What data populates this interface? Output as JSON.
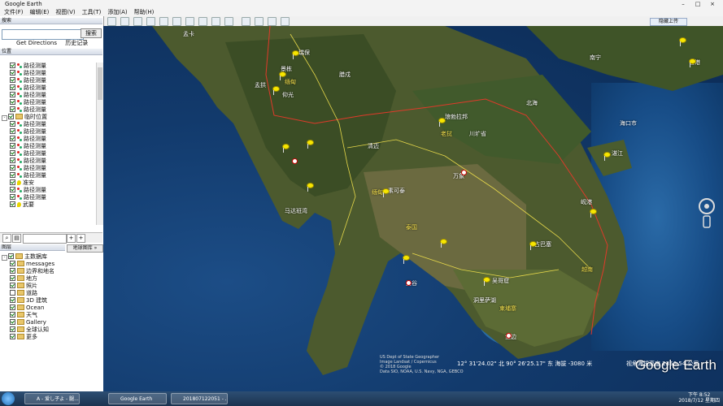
{
  "window": {
    "title": "Google Earth"
  },
  "menu": [
    "文件(F)",
    "编辑(E)",
    "视图(V)",
    "工具(T)",
    "添加(A)",
    "帮助(H)"
  ],
  "toolbar": {
    "signin_label": "隐藏上传"
  },
  "search": {
    "header": "搜索",
    "button": "搜索",
    "get_directions": "Get Directions",
    "history": "历史记录"
  },
  "places": {
    "header": "位置",
    "items": [
      {
        "label": "路径测量",
        "kind": "path",
        "depth": 2
      },
      {
        "label": "路径测量",
        "kind": "path",
        "depth": 2
      },
      {
        "label": "路径测量",
        "kind": "path",
        "depth": 2
      },
      {
        "label": "路径测量",
        "kind": "path",
        "depth": 2
      },
      {
        "label": "路径测量",
        "kind": "path",
        "depth": 2
      },
      {
        "label": "路径测量",
        "kind": "path",
        "depth": 2
      },
      {
        "label": "路径测量",
        "kind": "path",
        "depth": 2
      },
      {
        "label": "临时位置",
        "kind": "folder",
        "depth": 0
      },
      {
        "label": "路径测量",
        "kind": "path",
        "depth": 2
      },
      {
        "label": "路径测量",
        "kind": "path",
        "depth": 2
      },
      {
        "label": "路径测量",
        "kind": "path",
        "depth": 2
      },
      {
        "label": "路径测量",
        "kind": "path",
        "depth": 2
      },
      {
        "label": "路径测量",
        "kind": "path",
        "depth": 2
      },
      {
        "label": "路径测量",
        "kind": "path",
        "depth": 2
      },
      {
        "label": "路径测量",
        "kind": "path",
        "depth": 2
      },
      {
        "label": "路径测量",
        "kind": "path",
        "depth": 2
      },
      {
        "label": "准安",
        "kind": "pin",
        "depth": 2
      },
      {
        "label": "路径测量",
        "kind": "path",
        "depth": 2
      },
      {
        "label": "路径测量",
        "kind": "path",
        "depth": 2
      },
      {
        "label": "武要",
        "kind": "pin",
        "depth": 2
      }
    ]
  },
  "layers": {
    "header": "图层",
    "gallery_button": "地球图库 »",
    "items": [
      {
        "label": "主数据库",
        "depth": 0
      },
      {
        "label": "messages",
        "depth": 1
      },
      {
        "label": "边界和地名",
        "depth": 1
      },
      {
        "label": "地方",
        "depth": 1
      },
      {
        "label": "照片",
        "depth": 1
      },
      {
        "label": "道路",
        "depth": 1
      },
      {
        "label": "3D 建筑",
        "depth": 1
      },
      {
        "label": "Ocean",
        "depth": 1
      },
      {
        "label": "天气",
        "depth": 1
      },
      {
        "label": "Gallery",
        "depth": 1
      },
      {
        "label": "全球认知",
        "depth": 1
      },
      {
        "label": "更多",
        "depth": 1
      }
    ]
  },
  "map": {
    "labels": [
      {
        "text": "孟卡",
        "color": "white"
      },
      {
        "text": "瑞保",
        "color": "white"
      },
      {
        "text": "景栋",
        "color": "white"
      },
      {
        "text": "孟拱",
        "color": "white"
      },
      {
        "text": "缅甸",
        "color": "yellow"
      },
      {
        "text": "仰光",
        "color": "white"
      },
      {
        "text": "缅甸",
        "color": "yellow"
      },
      {
        "text": "腊戍",
        "color": "white"
      },
      {
        "text": "南宁",
        "color": "white"
      },
      {
        "text": "北海",
        "color": "white"
      },
      {
        "text": "海口市",
        "color": "white"
      },
      {
        "text": "琅勃拉邦",
        "color": "white"
      },
      {
        "text": "老挝",
        "color": "yellow"
      },
      {
        "text": "川圹省",
        "color": "white"
      },
      {
        "text": "清迈",
        "color": "white"
      },
      {
        "text": "素可泰",
        "color": "white"
      },
      {
        "text": "万象",
        "color": "white"
      },
      {
        "text": "泰国",
        "color": "yellow"
      },
      {
        "text": "曼谷",
        "color": "white"
      },
      {
        "text": "柬埔寨",
        "color": "yellow"
      },
      {
        "text": "金边",
        "color": "white"
      },
      {
        "text": "岘港",
        "color": "white"
      },
      {
        "text": "越南",
        "color": "yellow"
      },
      {
        "text": "香港",
        "color": "white"
      },
      {
        "text": "湛江",
        "color": "white"
      },
      {
        "text": "占巴塞",
        "color": "white"
      },
      {
        "text": "吴哥窟",
        "color": "white"
      },
      {
        "text": "洞里萨湖",
        "color": "white"
      },
      {
        "text": "马达班湾",
        "color": "white"
      }
    ],
    "status": {
      "coords": "12° 31'24.02\" 北  90° 26'25.17\" 东  海拔  -3080 米",
      "eye_alt": "视角海拔高度 2356.54 公里"
    },
    "source_note": "US Dept of State Geographer\nImage Landsat / Copernicus\n© 2018 Google\nData SIO, NOAA, U.S. Navy, NGA, GEBCO",
    "logo": "Google Earth"
  },
  "taskbar": {
    "tasks": [
      "A - 爱し子よ - 腿...",
      "Google Earth",
      "201807122051 - ..."
    ],
    "clock_time": "下午 8:52",
    "clock_date": "2018/7/12 星期四"
  },
  "colors": {
    "border_red": "#e03a2a",
    "pin_yellow": "#f7e600",
    "label_yellow": "#f4e04d"
  }
}
